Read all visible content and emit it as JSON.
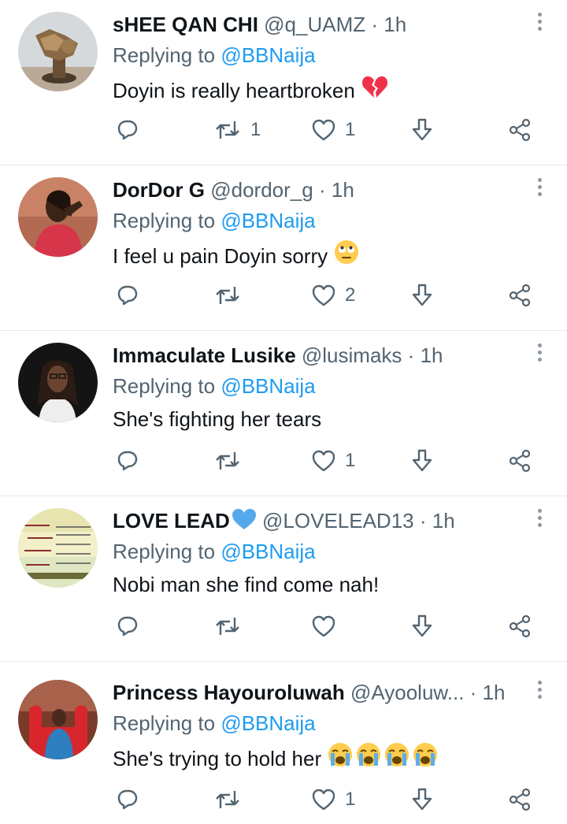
{
  "colors": {
    "accent": "#1d9bf0",
    "muted": "#536471",
    "text": "#0f1419",
    "divider": "#e6e9eb",
    "broken_heart": "#f0314a",
    "blue_heart": "#56a8ec"
  },
  "tweets": [
    {
      "name": "sHEE QAN CHI",
      "handle": "@q_UAMZ",
      "sep": "·",
      "time": "1h",
      "reply_prefix": "Replying to",
      "reply_to": "@BBNaija",
      "text": "Doyin is really heartbroken",
      "emojis": [
        "broken-heart-icon"
      ],
      "retweets": "1",
      "likes": "1",
      "avatar": "bronze-sculpture"
    },
    {
      "name": "DorDor G",
      "handle": "@dordor_g",
      "sep": "·",
      "time": "1h",
      "reply_prefix": "Replying to",
      "reply_to": "@BBNaija",
      "text": "I feel u pain Doyin sorry",
      "emojis": [
        "face-with-rolling-eyes-icon"
      ],
      "retweets": "",
      "likes": "2",
      "avatar": "woman-red-outfit"
    },
    {
      "name": "Immaculate Lusike",
      "handle": "@lusimaks",
      "sep": "·",
      "time": "1h",
      "reply_prefix": "Replying to",
      "reply_to": "@BBNaija",
      "text": "She's fighting her tears",
      "emojis": [],
      "retweets": "",
      "likes": "1",
      "avatar": "woman-braids"
    },
    {
      "name": "LOVE LEAD",
      "handle": "@LOVELEAD13",
      "sep": "·",
      "time": "1h",
      "reply_prefix": "Replying to",
      "reply_to": "@BBNaija",
      "text": "Nobi man she find come nah!",
      "emojis": [],
      "retweets": "",
      "likes": "",
      "avatar": "prayer-text-image"
    },
    {
      "name": "Princess Hayouroluwah",
      "handle": "@Ayooluw...",
      "sep": "·",
      "time": "1h",
      "reply_prefix": "Replying to",
      "reply_to": "@BBNaija",
      "text": "She's trying to hold her",
      "emojis": [
        "loudly-crying-face-icon",
        "loudly-crying-face-icon",
        "loudly-crying-face-icon",
        "loudly-crying-face-icon"
      ],
      "retweets": "",
      "likes": "1",
      "avatar": "woman-red-chair"
    }
  ]
}
